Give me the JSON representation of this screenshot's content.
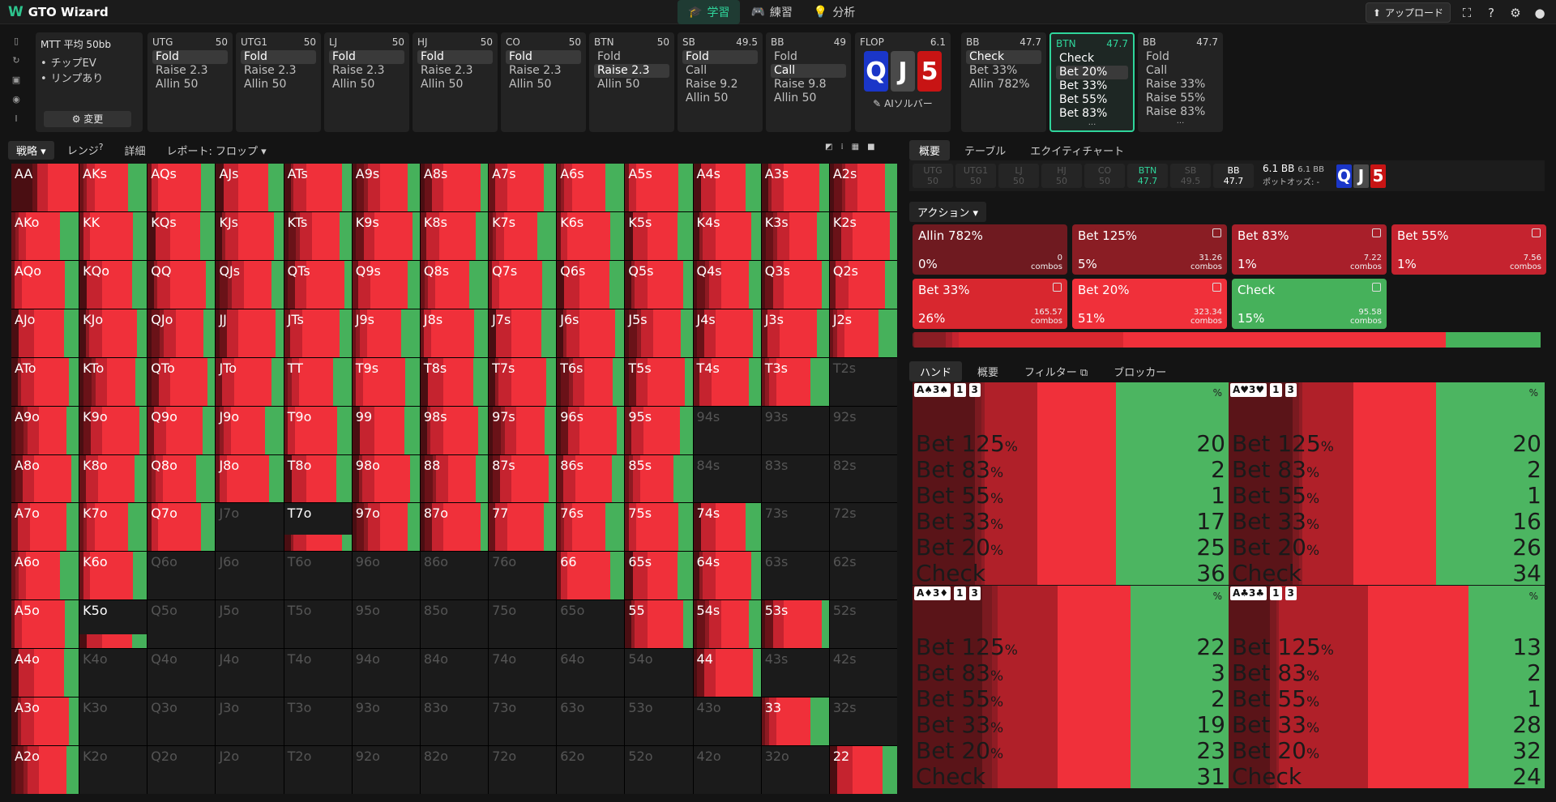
{
  "app": {
    "name": "GTO Wizard",
    "nav": [
      "学習",
      "練習",
      "分析"
    ],
    "upload": "アップロード"
  },
  "mtt": {
    "title": "MTT 平均 50bb",
    "items": [
      "チップEV",
      "リンプあり"
    ],
    "button": "変更"
  },
  "seats": [
    {
      "pos": "UTG",
      "stack": "50",
      "actions": [
        "Fold",
        "Raise 2.3",
        "Allin 50"
      ],
      "sel": 0
    },
    {
      "pos": "UTG1",
      "stack": "50",
      "actions": [
        "Fold",
        "Raise 2.3",
        "Allin 50"
      ],
      "sel": 0
    },
    {
      "pos": "LJ",
      "stack": "50",
      "actions": [
        "Fold",
        "Raise 2.3",
        "Allin 50"
      ],
      "sel": 0
    },
    {
      "pos": "HJ",
      "stack": "50",
      "actions": [
        "Fold",
        "Raise 2.3",
        "Allin 50"
      ],
      "sel": 0
    },
    {
      "pos": "CO",
      "stack": "50",
      "actions": [
        "Fold",
        "Raise 2.3",
        "Allin 50"
      ],
      "sel": 0
    },
    {
      "pos": "BTN",
      "stack": "50",
      "actions": [
        "Fold",
        "Raise 2.3",
        "Allin 50"
      ],
      "sel": 1
    },
    {
      "pos": "SB",
      "stack": "49.5",
      "actions": [
        "Fold",
        "Call",
        "Raise 9.2",
        "Allin 50"
      ],
      "sel": 0
    },
    {
      "pos": "BB",
      "stack": "49",
      "actions": [
        "Fold",
        "Call",
        "Raise 9.8",
        "Allin 50"
      ],
      "sel": 1
    }
  ],
  "flop": {
    "label": "FLOP",
    "pot": "6.1",
    "cards": [
      "Q",
      "J",
      "5"
    ],
    "ai": "AIソルバー"
  },
  "postflop": [
    {
      "pos": "BB",
      "stack": "47.7",
      "actions": [
        "Check",
        "Bet 33%",
        "Allin 782%"
      ],
      "sel": 0
    },
    {
      "pos": "BTN",
      "stack": "47.7",
      "actions": [
        "Check",
        "Bet 20%",
        "Bet 33%",
        "Bet 55%",
        "Bet 83%"
      ],
      "sel": 1
    },
    {
      "pos": "BB",
      "stack": "47.7",
      "actions": [
        "Fold",
        "Call",
        "Raise 33%",
        "Raise 55%",
        "Raise 83%"
      ],
      "sel": -1
    }
  ],
  "left_tabs": [
    "戦略",
    "レンジ",
    "詳細",
    "レポート: フロップ"
  ],
  "right_tabs": [
    "概要",
    "テーブル",
    "エクイティチャート"
  ],
  "posbar": [
    {
      "p": "UTG",
      "s": "50"
    },
    {
      "p": "UTG1",
      "s": "50"
    },
    {
      "p": "LJ",
      "s": "50"
    },
    {
      "p": "HJ",
      "s": "50"
    },
    {
      "p": "CO",
      "s": "50"
    },
    {
      "p": "BTN",
      "s": "47.7"
    },
    {
      "p": "SB",
      "s": "49.5"
    },
    {
      "p": "BB",
      "s": "47.7"
    }
  ],
  "pot": {
    "a": "6.1 BB",
    "b": "6.1 BB",
    "label": "ポットオッズ: -"
  },
  "action_dropdown": "アクション",
  "actions": [
    {
      "name": "Allin 782%",
      "pct": "0%",
      "combos": "0",
      "color": "#6f1a20"
    },
    {
      "name": "Bet 125%",
      "pct": "5%",
      "combos": "31.26",
      "color": "#8a1d24"
    },
    {
      "name": "Bet 83%",
      "pct": "1%",
      "combos": "7.22",
      "color": "#a81f2a"
    },
    {
      "name": "Bet 55%",
      "pct": "1%",
      "combos": "7.56",
      "color": "#c5232f"
    },
    {
      "name": "Bet 33%",
      "pct": "26%",
      "combos": "165.57",
      "color": "#d8272f"
    },
    {
      "name": "Bet 20%",
      "pct": "51%",
      "combos": "323.34",
      "color": "#f0303a"
    },
    {
      "name": "Check",
      "pct": "15%",
      "combos": "95.58",
      "color": "#46b15b"
    }
  ],
  "combos_label": "combos",
  "hand_tabs": [
    "ハンド",
    "概要",
    "フィルター",
    "ブロッカー"
  ],
  "hands": [
    {
      "cards": "A♠3♠",
      "b1": "1",
      "b2": "3",
      "vals": [
        "20",
        "2",
        "1",
        "17",
        "25",
        "36"
      ]
    },
    {
      "cards": "A♥3♥",
      "b1": "1",
      "b2": "3",
      "vals": [
        "20",
        "2",
        "1",
        "16",
        "26",
        "34"
      ]
    },
    {
      "cards": "A♦3♦",
      "b1": "1",
      "b2": "3",
      "vals": [
        "22",
        "3",
        "2",
        "19",
        "23",
        "31"
      ]
    },
    {
      "cards": "A♣3♣",
      "b1": "1",
      "b2": "3",
      "vals": [
        "13",
        "2",
        "1",
        "28",
        "32",
        "24"
      ]
    }
  ],
  "hand_rows": [
    "Bet 125",
    "Bet 83",
    "Bet 55",
    "Bet 33",
    "Bet 20",
    "Check"
  ],
  "grid": {
    "ranks": [
      "A",
      "K",
      "Q",
      "J",
      "T",
      "9",
      "8",
      "7",
      "6",
      "5",
      "4",
      "3",
      "2"
    ],
    "in": [
      "1111111111111",
      "1111111111111",
      "1111111111111",
      "1111111111111",
      "1111111111110",
      "1111111111000",
      "1111111111000",
      "1110111111100",
      "1100000011100",
      "1100000001110",
      "1000000000100",
      "1000000000010",
      "1000000000001"
    ],
    "partial": {
      "7,3": 0.35,
      "7,4": 0.35,
      "9,1": 0.3
    }
  }
}
